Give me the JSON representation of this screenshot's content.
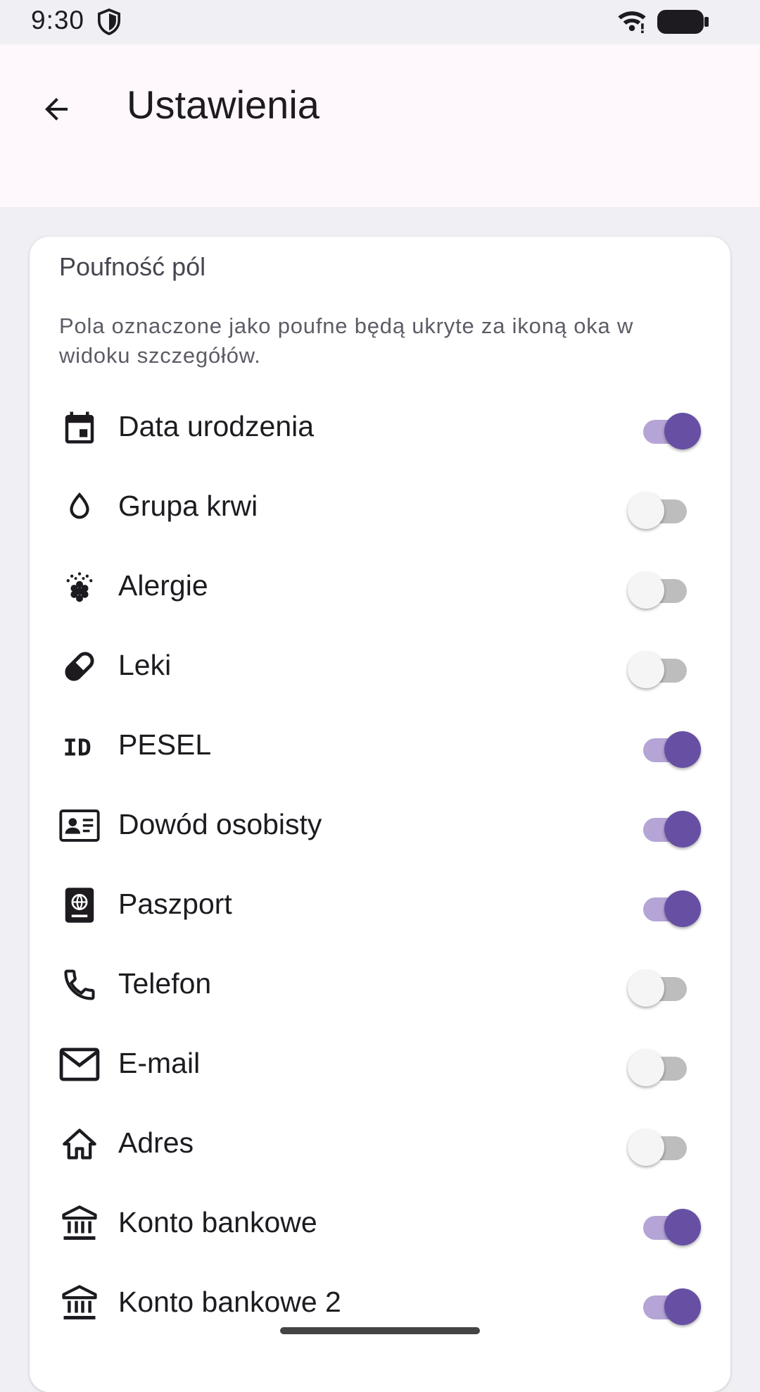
{
  "status_bar": {
    "time": "9:30",
    "icons": [
      "shield-icon",
      "wifi-icon",
      "battery-icon"
    ]
  },
  "app_bar": {
    "title": "Ustawienia",
    "back_icon": "arrow-back-icon"
  },
  "card": {
    "title": "Poufność pól",
    "description": "Pola oznaczone jako poufne będą ukryte za ikoną oka w widoku szczegółów.",
    "items": [
      {
        "label": "Data urodzenia",
        "icon": "calendar-icon",
        "checked": true
      },
      {
        "label": "Grupa krwi",
        "icon": "water-drop-icon",
        "checked": false
      },
      {
        "label": "Alergie",
        "icon": "allergy-icon",
        "checked": false
      },
      {
        "label": "Leki",
        "icon": "pill-icon",
        "checked": false
      },
      {
        "label": "PESEL",
        "icon": "id-icon",
        "checked": true
      },
      {
        "label": "Dowód osobisty",
        "icon": "id-card-icon",
        "checked": true
      },
      {
        "label": "Paszport",
        "icon": "passport-icon",
        "checked": true
      },
      {
        "label": "Telefon",
        "icon": "phone-icon",
        "checked": false
      },
      {
        "label": "E-mail",
        "icon": "mail-icon",
        "checked": false
      },
      {
        "label": "Adres",
        "icon": "home-icon",
        "checked": false
      },
      {
        "label": "Konto bankowe",
        "icon": "bank-icon",
        "checked": true
      },
      {
        "label": "Konto bankowe 2",
        "icon": "bank-icon",
        "checked": true
      }
    ]
  },
  "colors": {
    "accent": "#6750A4",
    "accent_track": "#B4A5D6",
    "app_bar_bg": "#FEF7FC",
    "screen_bg": "#F0EFF4"
  }
}
